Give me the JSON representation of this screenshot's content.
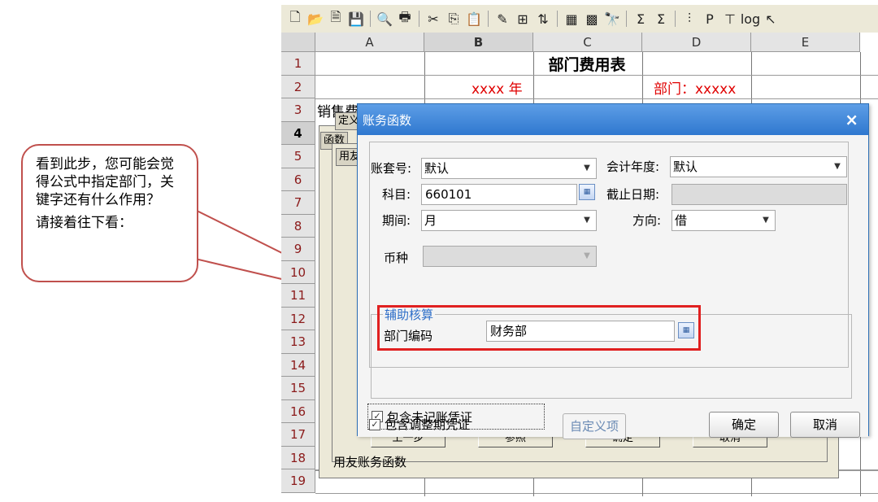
{
  "callout": {
    "text1": "看到此步，您可能会觉得公式中指定部门，关键字还有什么作用？",
    "text2": "请接着往下看："
  },
  "toolbar": {
    "icons": [
      "new-file-icon",
      "open-folder-icon",
      "document-icon",
      "save-icon",
      "print-preview-icon",
      "print-icon",
      "cut-icon",
      "copy-icon",
      "paste-icon",
      "format-painter-icon",
      "insert-column-icon",
      "sort-icon",
      "table-icon",
      "grid-icon",
      "find-icon",
      "sum-icon",
      "sum-total-icon",
      "chart-icon",
      "p-icon",
      "filter-icon",
      "log-icon",
      "pointer-icon"
    ],
    "glyphs": [
      "🗋",
      "📂",
      "🗎",
      "💾",
      "🔍",
      "🖶",
      "✂",
      "⎘",
      "📋",
      "✎",
      "⊞",
      "⇅",
      "▦",
      "▩",
      "🔭",
      "Σ",
      "Σ",
      "⫶",
      "P",
      "⊤",
      "log",
      "↖"
    ]
  },
  "sheet": {
    "columns": [
      "A",
      "B",
      "C",
      "D",
      "E"
    ],
    "rows": [
      "1",
      "2",
      "3",
      "4",
      "5",
      "6",
      "7",
      "8",
      "9",
      "10",
      "11",
      "12",
      "13",
      "14",
      "15",
      "16",
      "17",
      "18",
      "19"
    ],
    "title": "部门费用表",
    "year_cell": "xxxx 年",
    "dept_cell": "部门：xxxxx",
    "a3_text": "销售费",
    "row18_text": "用友账务函数"
  },
  "bg_dialogs": {
    "tab1": "定义",
    "tab2": "函数",
    "tab3": "用友",
    "btn_prev": "上一步",
    "btn_ref": "参照",
    "btn_ok": "确定",
    "btn_cancel": "取消"
  },
  "dialog": {
    "title": "账务函数",
    "close": "×",
    "account_set_label": "账套号:",
    "account_set_value": "默认",
    "fiscal_year_label": "会计年度:",
    "fiscal_year_value": "默认",
    "subject_label": "科目:",
    "subject_value": "660101",
    "cutoff_date_label": "截止日期:",
    "cutoff_date_value": "",
    "period_label": "期间:",
    "period_value": "月",
    "direction_label": "方向:",
    "direction_value": "借",
    "currency_label": "币种",
    "currency_value": "",
    "aux_title": "辅助核算",
    "dept_code_label": "部门编码",
    "dept_code_value": "财务部",
    "include_unposted": "包含未记账凭证",
    "include_adjust": "包含调整期凭证",
    "custom_button": "自定义项",
    "ok_button": "确定",
    "cancel_button": "取消"
  }
}
